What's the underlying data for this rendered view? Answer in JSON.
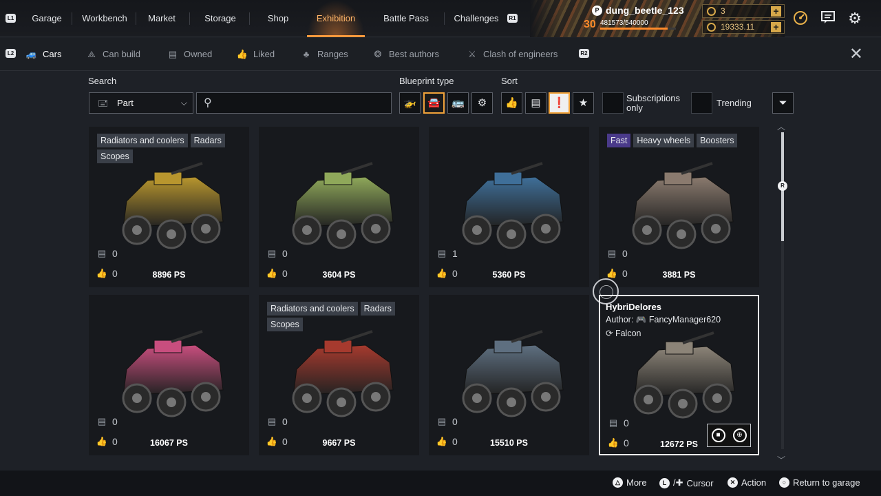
{
  "topnav": {
    "l1": "L1",
    "r1": "R1",
    "tabs": [
      {
        "label": "Garage"
      },
      {
        "label": "Workbench"
      },
      {
        "label": "Market"
      },
      {
        "label": "Storage"
      },
      {
        "label": "Shop"
      },
      {
        "label": "Exhibition",
        "active": true
      },
      {
        "label": "Battle Pass"
      },
      {
        "label": "Challenges"
      }
    ]
  },
  "player": {
    "name": "dung_beetle_123",
    "level": "30",
    "xp": "481573/540000",
    "xp_fraction": 0.892,
    "currency_1": "3",
    "currency_2": "19333.11"
  },
  "subnav": {
    "l2": "L2",
    "r2": "R2",
    "tabs": [
      {
        "label": "Cars",
        "icon": "car-icon",
        "active": true
      },
      {
        "label": "Can build",
        "icon": "compass-icon"
      },
      {
        "label": "Owned",
        "icon": "save-icon"
      },
      {
        "label": "Liked",
        "icon": "thumbs-up-icon"
      },
      {
        "label": "Ranges",
        "icon": "ranges-icon"
      },
      {
        "label": "Best authors",
        "icon": "best-authors-icon"
      },
      {
        "label": "Clash of engineers",
        "icon": "clash-icon"
      }
    ]
  },
  "filters": {
    "search_label": "Search",
    "part_select": "Part",
    "search_value": "",
    "blueprint_label": "Blueprint type",
    "sort_label": "Sort",
    "subscriptions_label": "Subscriptions only",
    "trending_label": "Trending"
  },
  "cards": [
    {
      "tags": [
        "Radiators and coolers",
        "Radars",
        "Scopes"
      ],
      "downloads": "0",
      "likes": "0",
      "ps": "8896 PS",
      "color": "#b8962e"
    },
    {
      "tags": [],
      "downloads": "0",
      "likes": "0",
      "ps": "3604 PS",
      "color": "#8fa85a"
    },
    {
      "tags": [],
      "downloads": "1",
      "likes": "0",
      "ps": "5360 PS",
      "color": "#3f6f99"
    },
    {
      "tags": [
        "Fast",
        "Heavy wheels",
        "Boosters"
      ],
      "downloads": "0",
      "likes": "0",
      "ps": "3881 PS",
      "color": "#8a7a6e"
    },
    {
      "tags": [],
      "downloads": "0",
      "likes": "0",
      "ps": "16067 PS",
      "color": "#c84e7e"
    },
    {
      "tags": [
        "Radiators and coolers",
        "Radars",
        "Scopes"
      ],
      "downloads": "0",
      "likes": "0",
      "ps": "9667 PS",
      "color": "#a63a2e"
    },
    {
      "tags": [],
      "downloads": "0",
      "likes": "0",
      "ps": "15510 PS",
      "color": "#5e6f80"
    },
    {
      "tags": [],
      "downloads": "0",
      "likes": "0",
      "ps": "12672 PS",
      "color": "#8c8478",
      "focused": true,
      "name": "HybriDelores",
      "author_prefix": "Author:",
      "author": "FancyManager620",
      "cabin": "Falcon"
    }
  ],
  "footer": {
    "more": "More",
    "cursor": "Cursor",
    "action": "Action",
    "return": "Return to garage"
  }
}
